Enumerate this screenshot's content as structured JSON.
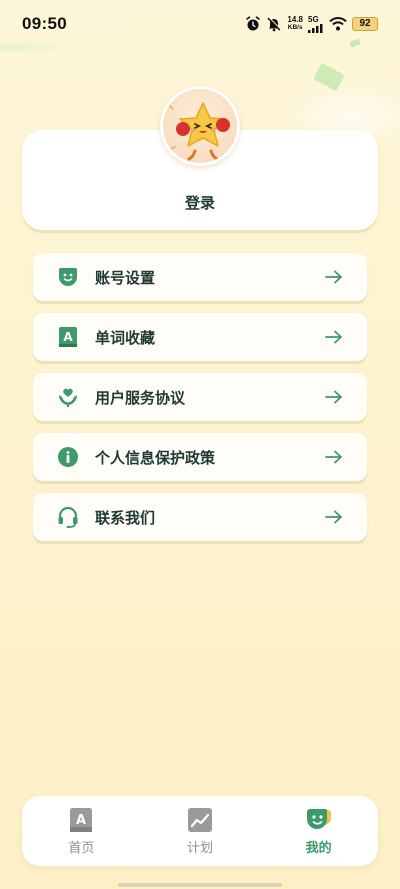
{
  "status_bar": {
    "time": "09:50",
    "net_speed_value": "14.8",
    "net_speed_unit": "KB/s",
    "network": "5G",
    "battery": "92",
    "icons": [
      "alarm-icon",
      "mute-icon",
      "signal-icon",
      "wifi-icon",
      "battery-icon"
    ]
  },
  "profile": {
    "login_label": "登录",
    "avatar": "star-mascot-avatar"
  },
  "menu": {
    "items": [
      {
        "label": "账号设置",
        "icon": "smile-face-icon"
      },
      {
        "label": "单词收藏",
        "icon": "word-book-icon"
      },
      {
        "label": "用户服务协议",
        "icon": "hands-heart-icon"
      },
      {
        "label": "个人信息保护政策",
        "icon": "info-icon"
      },
      {
        "label": "联系我们",
        "icon": "headset-icon"
      }
    ],
    "arrow_icon": "arrow-right-icon"
  },
  "bottom_nav": {
    "tabs": [
      {
        "label": "首页",
        "icon": "home-book-icon",
        "active": false
      },
      {
        "label": "计划",
        "icon": "plan-chart-icon",
        "active": false
      },
      {
        "label": "我的",
        "icon": "profile-face-icon",
        "active": true
      }
    ]
  },
  "colors": {
    "accent": "#3d9a6b",
    "background": "#fdf3cf",
    "inactive": "#8f8f8f"
  }
}
